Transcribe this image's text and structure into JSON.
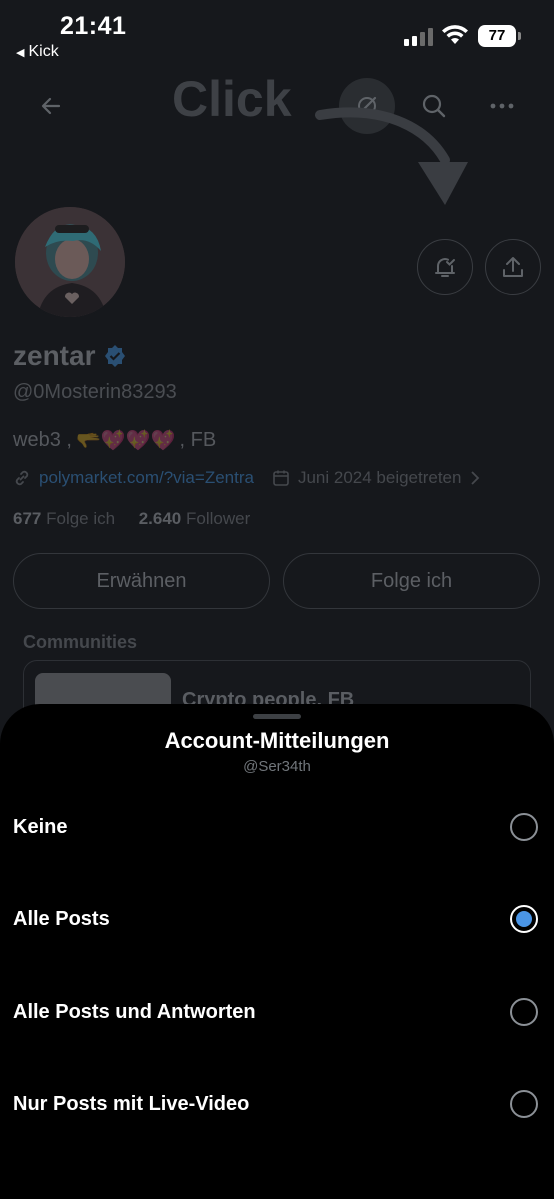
{
  "status_bar": {
    "time": "21:41",
    "back_app": "Kick",
    "battery": "77"
  },
  "overlay": {
    "click_text": "Click"
  },
  "profile": {
    "name": "zentar",
    "handle": "@0Mosterin83293",
    "bio_prefix": "web3 ,",
    "bio_emojis": "🫳💖💖💖",
    "bio_suffix": ", FB",
    "link": "polymarket.com/?via=Zentra",
    "joined": "Juni 2024 beigetreten",
    "following_count": "677",
    "following_label": "Folge ich",
    "followers_count": "2.640",
    "followers_label": "Follower",
    "mention_button": "Erwähnen",
    "follow_button": "Folge ich",
    "communities_label": "Communities",
    "community_name": "Crypto people, FB"
  },
  "sheet": {
    "title": "Account-Mitteilungen",
    "subtitle": "@Ser34th",
    "options": [
      {
        "label": "Keine",
        "selected": false
      },
      {
        "label": "Alle Posts",
        "selected": true
      },
      {
        "label": "Alle Posts und Antworten",
        "selected": false
      },
      {
        "label": "Nur Posts mit Live-Video",
        "selected": false
      }
    ]
  },
  "colors": {
    "accent_blue": "#4a95e6",
    "sheet_bg": "#000000",
    "background": "#16181c"
  },
  "icons": [
    "back-arrow-icon",
    "grok-icon",
    "search-icon",
    "more-icon",
    "bell-check-icon",
    "share-icon",
    "verified-badge-icon",
    "link-icon",
    "calendar-icon",
    "chevron-right-icon"
  ]
}
